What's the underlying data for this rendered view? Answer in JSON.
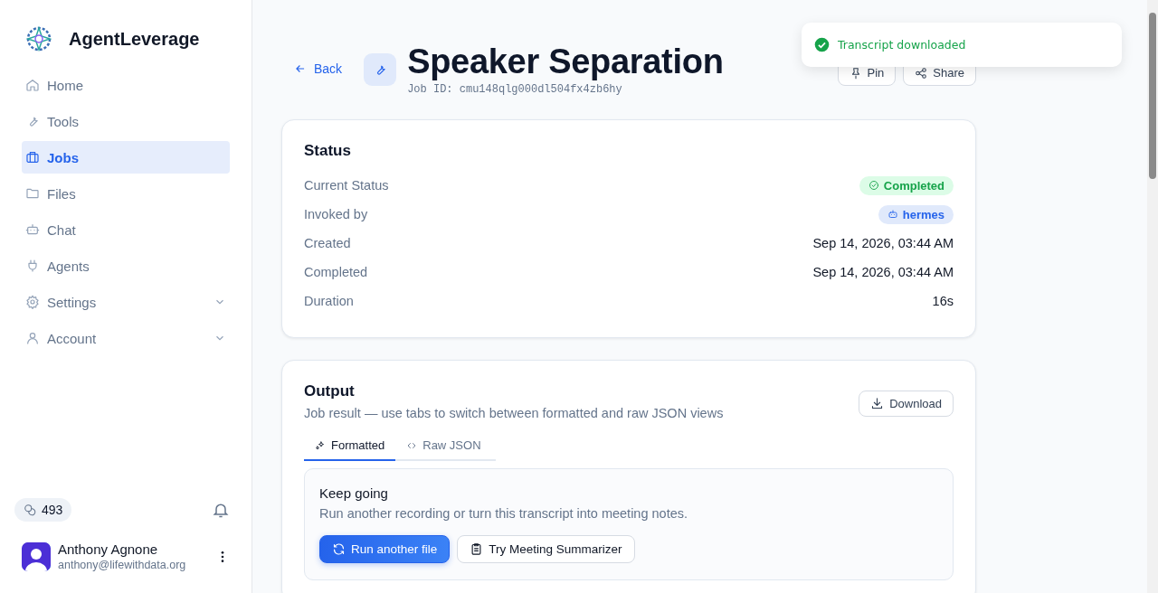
{
  "sidebar": {
    "brand": "AgentLeverage",
    "items": [
      {
        "label": "Home",
        "selected": false,
        "expandable": false
      },
      {
        "label": "Tools",
        "selected": false,
        "expandable": false
      },
      {
        "label": "Jobs",
        "selected": true,
        "expandable": false
      },
      {
        "label": "Files",
        "selected": false,
        "expandable": false
      },
      {
        "label": "Chat",
        "selected": false,
        "expandable": false
      },
      {
        "label": "Agents",
        "selected": false,
        "expandable": false
      },
      {
        "label": "Settings",
        "selected": false,
        "expandable": true
      },
      {
        "label": "Account",
        "selected": false,
        "expandable": true
      }
    ],
    "credits": "493",
    "user": {
      "name": "Anthony Agnone",
      "email": "anthony@lifewithdata.org"
    }
  },
  "header": {
    "back": "Back",
    "title": "Speaker Separation",
    "job_id": "Job ID: cmu148qlg000dl504fx4zb6hy",
    "actions": [
      "Pin",
      "Share"
    ]
  },
  "toast": {
    "message": "Transcript downloaded"
  },
  "status": {
    "title": "Status",
    "rows": [
      {
        "label": "Current Status",
        "value": "Completed",
        "kind": "status-badge"
      },
      {
        "label": "Invoked by",
        "value": "hermes",
        "kind": "agent-badge"
      },
      {
        "label": "Created",
        "value": "Sep 14, 2026, 03:44 AM",
        "kind": "text"
      },
      {
        "label": "Completed",
        "value": "Sep 14, 2026, 03:44 AM",
        "kind": "text"
      },
      {
        "label": "Duration",
        "value": "16s",
        "kind": "text"
      }
    ]
  },
  "output": {
    "title": "Output",
    "subtitle": "Job result — use tabs to switch between formatted and raw JSON views",
    "download": "Download",
    "tabs": [
      {
        "label": "Formatted",
        "selected": true
      },
      {
        "label": "Raw JSON",
        "selected": false
      }
    ],
    "panel": {
      "title": "Keep going",
      "text": "Run another recording or turn this transcript into meeting notes.",
      "buttons": [
        {
          "label": "Run another file",
          "kind": "primary"
        },
        {
          "label": "Try Meeting Summarizer",
          "kind": "secondary"
        }
      ]
    }
  }
}
